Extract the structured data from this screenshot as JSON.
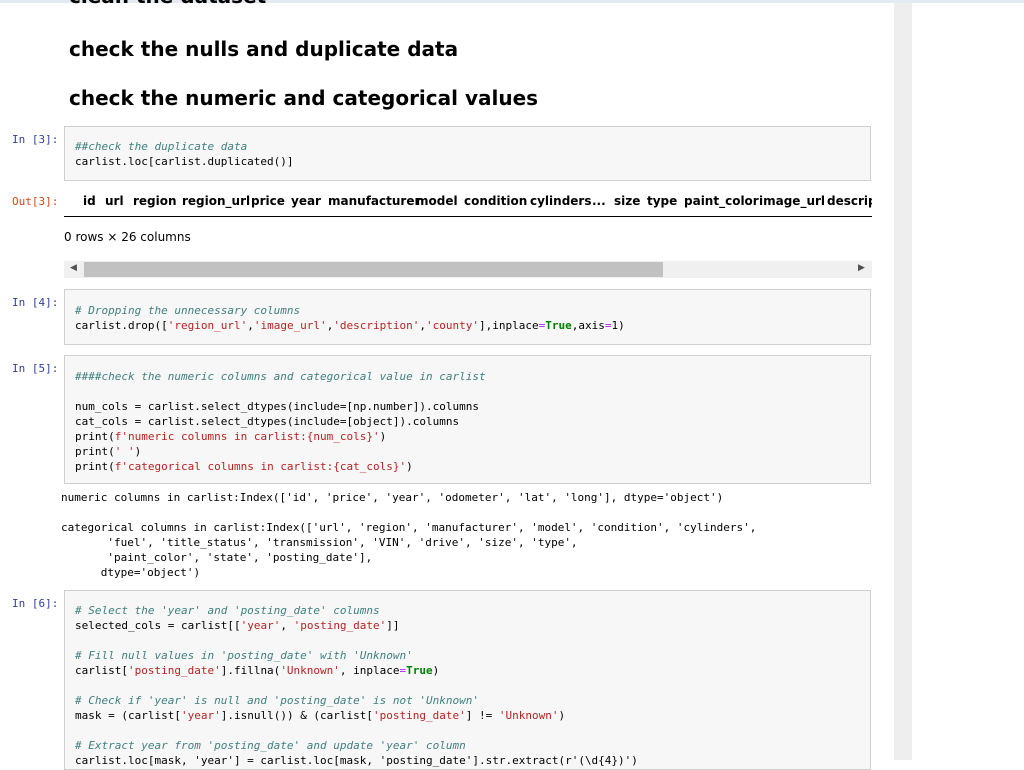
{
  "headings": {
    "clipped": "clean the dataset",
    "nulls": "check the nulls and duplicate data",
    "numeric": "check the numeric and categorical values"
  },
  "cells": {
    "c3": {
      "prompt": "In [3]:",
      "comment": "##check the duplicate data",
      "line2": "carlist.loc[carlist.duplicated()]",
      "out_prompt": "Out[3]:"
    },
    "c4": {
      "prompt": "In [4]:",
      "comment": "# Dropping the unnecessary columns",
      "l2a": "carlist.drop([",
      "s1": "'region_url'",
      "s2": "'image_url'",
      "s3": "'description'",
      "s4": "'county'",
      "l2b": "],inplace",
      "kw_true": "True",
      "l2c": ",axis",
      "l2d": "1)"
    },
    "c5": {
      "prompt": "In [5]:",
      "comment": "####check the numeric columns and categorical value in carlist",
      "l1": "num_cols = carlist.select_dtypes(include=[np.number]).columns",
      "l2": "cat_cols = carlist.select_dtypes(include=[object]).columns",
      "l3a": "print(",
      "l3s": "f'numeric columns in carlist:{num_cols}'",
      "l3b": ")",
      "l4a": "print(",
      "l4s": "' '",
      "l4b": ")",
      "l5a": "print(",
      "l5s": "f'categorical columns in carlist:{cat_cols}'",
      "l5b": ")",
      "out_numeric": "numeric columns in carlist:Index(['id', 'price', 'year', 'odometer', 'lat', 'long'], dtype='object')",
      "out_cat_1": "categorical columns in carlist:Index(['url', 'region', 'manufacturer', 'model', 'condition', 'cylinders',",
      "out_cat_2": "       'fuel', 'title_status', 'transmission', 'VIN', 'drive', 'size', 'type',",
      "out_cat_3": "       'paint_color', 'state', 'posting_date'],",
      "out_cat_4": "      dtype='object')"
    },
    "c6": {
      "prompt": "In [6]:",
      "c1": "# Select the 'year' and 'posting_date' columns",
      "l1a": "selected_cols = carlist[[",
      "l1s1": "'year'",
      "l1s2": "'posting_date'",
      "l1b": "]]",
      "c2": "# Fill null values in 'posting_date' with 'Unknown'",
      "l2a": "carlist[",
      "l2s1": "'posting_date'",
      "l2b": "].fillna(",
      "l2s2": "'Unknown'",
      "l2c": ", inplace",
      "l2kw": "True",
      "l2d": ")",
      "c3": "# Check if 'year' is null and 'posting_date' is not 'Unknown'",
      "l3a": "mask = (carlist[",
      "l3s1": "'year'",
      "l3b": "].isnull()) & (carlist[",
      "l3s2": "'posting_date'",
      "l3c": "] != ",
      "l3s3": "'Unknown'",
      "l3d": ")",
      "c4": "# Extract year from 'posting_date' and update 'year' column",
      "l4": "carlist.loc[mask, 'year'] = carlist.loc[mask, 'posting_date'].str.extract(r'(\\d{4})')"
    }
  },
  "dataframe": {
    "columns": [
      "id",
      "url",
      "region",
      "region_url",
      "price",
      "year",
      "manufacturer",
      "model",
      "condition",
      "cylinders",
      "...",
      "size",
      "type",
      "paint_color",
      "image_url",
      "descript"
    ],
    "rows_info": "0 rows × 26 columns"
  },
  "scrollbar": {
    "left_arrow": "◀",
    "right_arrow": "▶"
  }
}
